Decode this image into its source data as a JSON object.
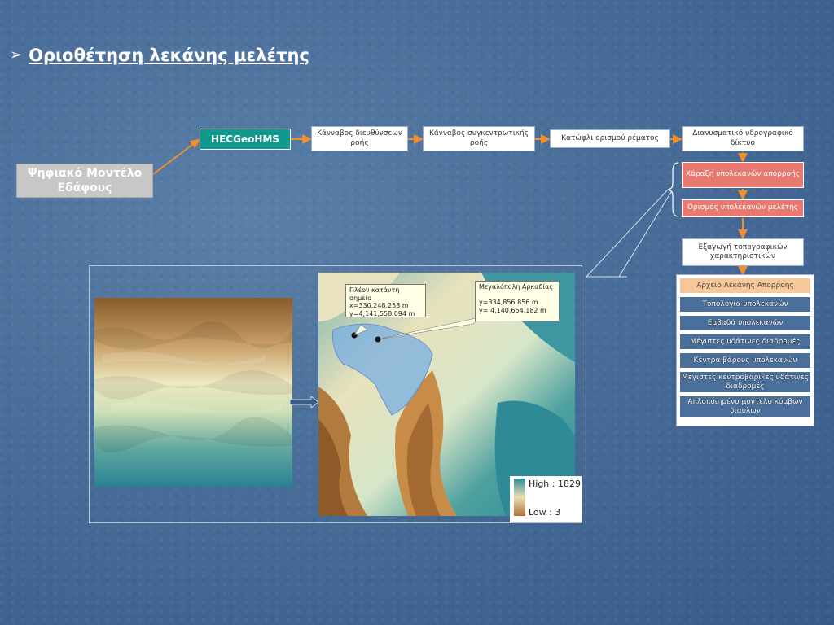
{
  "slide": {
    "title": "Οριοθέτηση λεκάνης μελέτης",
    "bullet_icon": "arrow-bullet-icon"
  },
  "flow": {
    "dem_label": "Ψηφιακό Μοντέλο Εδάφους",
    "hecgeohms_label": "HECGeoHMS",
    "steps": [
      "Κάνναβος διευθύνσεων ροής",
      "Κάνναβος συγκεντρωτικής ροής",
      "Κατώφλι ορισμού ρέματος",
      "Διανυσματικό υδρογραφικό δίκτυο"
    ],
    "sub_steps": [
      "Χάραξη υπολεκανών απορροής",
      "Ορισμός υπολεκανών μελέτης"
    ],
    "export_label": "Εξαγωγή τοπογραφικών χαρακτηριστικών"
  },
  "outputs": {
    "items": [
      "Αρχείο Λεκάνης Απορροής",
      "Τοπολογία υπολεκανών",
      "Εμβαδά υπολεκανών",
      "Μέγιστες υδάτινες διαδρομές",
      "Κέντρα βάρους υπολεκανών",
      "Μέγιστες κεντροβαρικές υδάτινες διαδρομές",
      "Απλοποιημένο μοντέλο κόμβων διαύλων"
    ]
  },
  "map": {
    "callout_outlet": "Πλέον κατάντη σημείο\nx=330,248.253 m\ny=4,141,558.094 m",
    "callout_city": "Μεγαλόπολη Αρκαδίας\n\ny=334,856.856 m\ny= 4,140,654.182 m",
    "legend_high": "High : 1829",
    "legend_low": "Low : 3"
  },
  "colors": {
    "accent_teal": "#0e9a8e",
    "accent_red": "#e77a70",
    "connector_orange": "#f0902c",
    "highlight_peach": "#f6c79a"
  }
}
